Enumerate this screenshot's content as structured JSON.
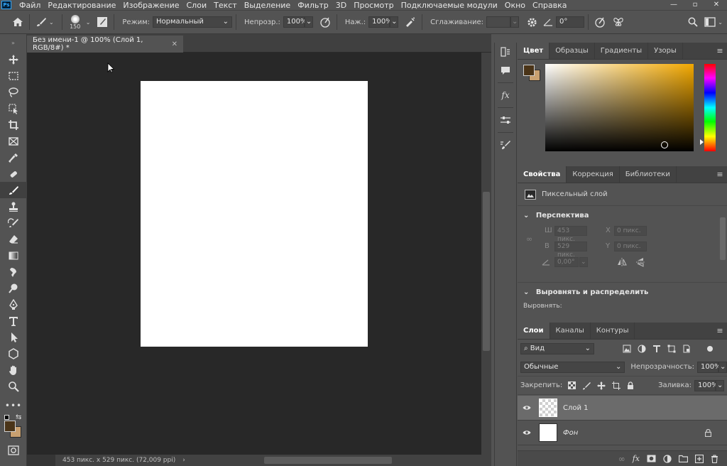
{
  "app": {
    "logo": "Ps",
    "menu": [
      "Файл",
      "Редактирование",
      "Изображение",
      "Слои",
      "Текст",
      "Выделение",
      "Фильтр",
      "3D",
      "Просмотр",
      "Подключаемые модули",
      "Окно",
      "Справка"
    ]
  },
  "options": {
    "brush_size": "150",
    "mode_label": "Режим:",
    "mode_value": "Нормальный",
    "opacity_label": "Непрозр.:",
    "opacity_value": "100%",
    "flow_label": "Наж.:",
    "flow_value": "100%",
    "smoothing_label": "Сглаживание:",
    "smoothing_value": "",
    "angle_value": "0°"
  },
  "document": {
    "tab_title": "Без имени-1 @ 100% (Слой 1, RGB/8#) *",
    "status": "453 пикс. x 529 пикс. (72,009 ppi)"
  },
  "color_panel": {
    "tabs": [
      "Цвет",
      "Образцы",
      "Градиенты",
      "Узоры"
    ],
    "foreground": "#4a3418",
    "background": "#c8a070",
    "hue_color": "#f2a800"
  },
  "properties_panel": {
    "tabs": [
      "Свойства",
      "Коррекция",
      "Библиотеки"
    ],
    "layer_type": "Пиксельный слой",
    "perspective_section": "Перспектива",
    "w_label": "Ш",
    "w_value": "453 пикс.",
    "h_label": "В",
    "h_value": "529 пикс.",
    "x_label": "X",
    "x_value": "0 пикс.",
    "y_label": "Y",
    "y_value": "0 пикс.",
    "angle_value": "0,00°",
    "align_section": "Выровнять и распределить",
    "align_label": "Выровнять:"
  },
  "layers_panel": {
    "tabs": [
      "Слои",
      "Каналы",
      "Контуры"
    ],
    "filter_label": "Вид",
    "blend_mode": "Обычные",
    "opacity_label": "Непрозрачность:",
    "opacity_value": "100%",
    "lock_label": "Закрепить:",
    "fill_label": "Заливка:",
    "fill_value": "100%",
    "layers": [
      {
        "name": "Слой 1"
      },
      {
        "name": "Фон"
      }
    ]
  }
}
